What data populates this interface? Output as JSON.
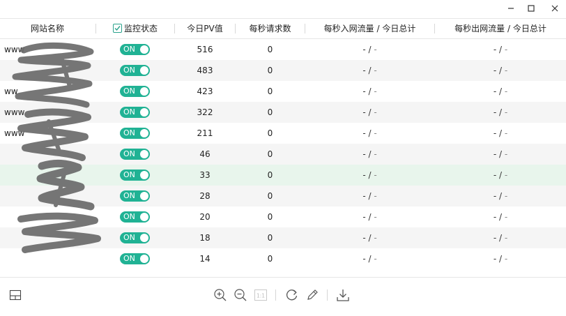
{
  "header": {
    "site_name": "网站名称",
    "monitor_status": "监控状态",
    "pv_today": "今日PV值",
    "rps": "每秒请求数",
    "in_traffic": "每秒入网流量 / 今日总计",
    "out_traffic": "每秒出网流量 / 今日总计"
  },
  "rows": [
    {
      "name": "www",
      "status": "ON",
      "pv": "516",
      "rps": "0",
      "in_now": "-",
      "in_total": "-",
      "out_now": "-",
      "out_total": "-"
    },
    {
      "name": "",
      "status": "ON",
      "pv": "483",
      "rps": "0",
      "in_now": "-",
      "in_total": "-",
      "out_now": "-",
      "out_total": "-"
    },
    {
      "name": "ww",
      "status": "ON",
      "pv": "423",
      "rps": "0",
      "in_now": "-",
      "in_total": "-",
      "out_now": "-",
      "out_total": "-"
    },
    {
      "name": "www",
      "status": "ON",
      "pv": "322",
      "rps": "0",
      "in_now": "-",
      "in_total": "-",
      "out_now": "-",
      "out_total": "-"
    },
    {
      "name": "www",
      "status": "ON",
      "pv": "211",
      "rps": "0",
      "in_now": "-",
      "in_total": "-",
      "out_now": "-",
      "out_total": "-"
    },
    {
      "name": "",
      "status": "ON",
      "pv": "46",
      "rps": "0",
      "in_now": "-",
      "in_total": "-",
      "out_now": "-",
      "out_total": "-"
    },
    {
      "name": "",
      "status": "ON",
      "pv": "33",
      "rps": "0",
      "in_now": "-",
      "in_total": "-",
      "out_now": "-",
      "out_total": "-"
    },
    {
      "name": "",
      "status": "ON",
      "pv": "28",
      "rps": "0",
      "in_now": "-",
      "in_total": "-",
      "out_now": "-",
      "out_total": "-"
    },
    {
      "name": "",
      "status": "ON",
      "pv": "20",
      "rps": "0",
      "in_now": "-",
      "in_total": "-",
      "out_now": "-",
      "out_total": "-"
    },
    {
      "name": "",
      "status": "ON",
      "pv": "18",
      "rps": "0",
      "in_now": "-",
      "in_total": "-",
      "out_now": "-",
      "out_total": "-"
    },
    {
      "name": "",
      "status": "ON",
      "pv": "14",
      "rps": "0",
      "in_now": "-",
      "in_total": "-",
      "out_now": "-",
      "out_total": "-"
    }
  ],
  "zoom_reset_label": "1:1",
  "colors": {
    "toggle_on": "#20b294",
    "row_alt": "#f5f5f5",
    "row_highlight": "#e8f5ec",
    "scribble": "#6b6b6b"
  },
  "icons": [
    "minimize-icon",
    "maximize-icon",
    "close-icon",
    "layout-icon",
    "zoom-in-icon",
    "zoom-out-icon",
    "actual-size-icon",
    "refresh-icon",
    "edit-icon",
    "download-icon"
  ]
}
